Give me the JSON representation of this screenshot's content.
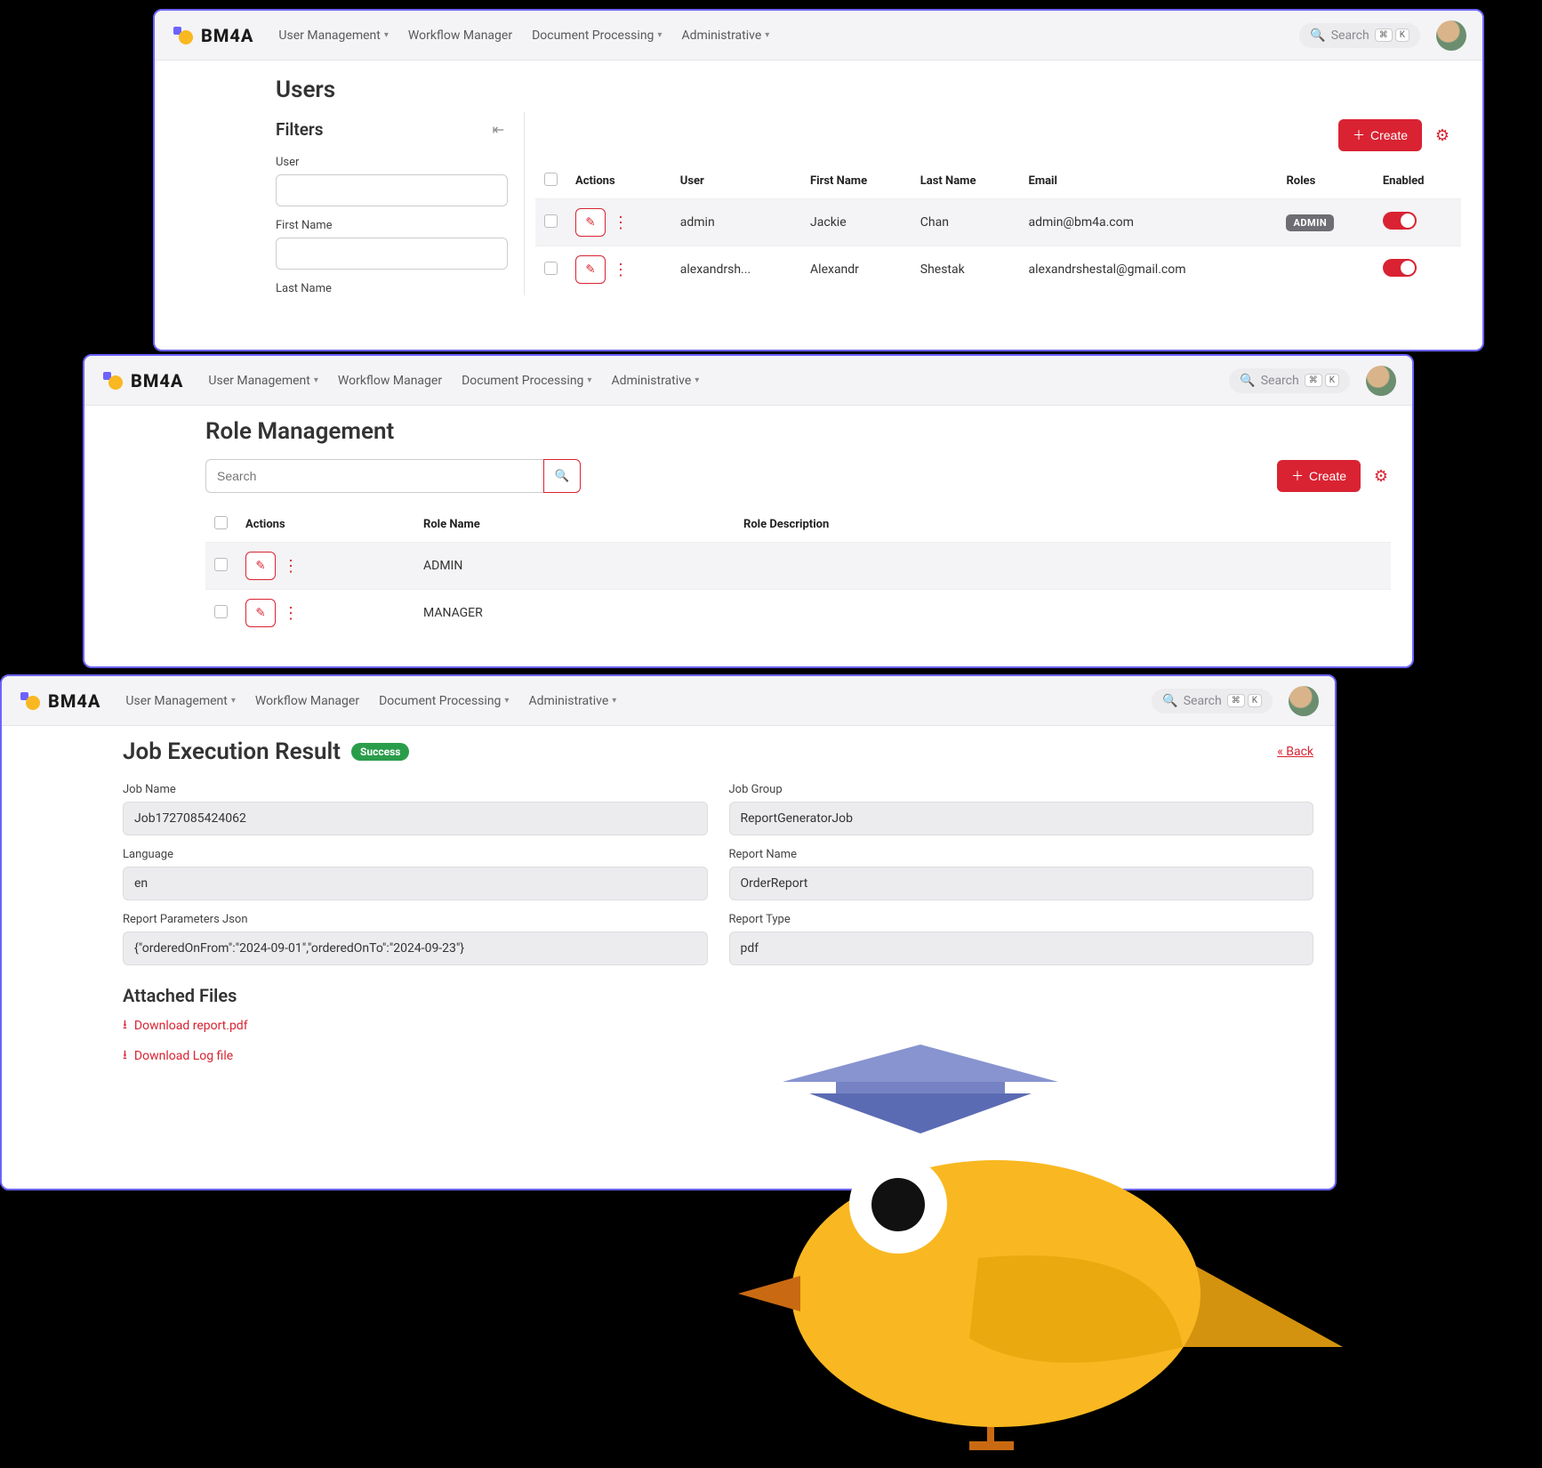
{
  "brand": "BM4A",
  "nav": {
    "items": [
      {
        "label": "User Management",
        "caret": true
      },
      {
        "label": "Workflow Manager",
        "caret": false
      },
      {
        "label": "Document Processing",
        "caret": true
      },
      {
        "label": "Administrative",
        "caret": true
      }
    ],
    "search_placeholder": "Search",
    "kbd1": "⌘",
    "kbd2": "K"
  },
  "win1": {
    "title": "Users",
    "filters_title": "Filters",
    "filter_user_label": "User",
    "filter_firstname_label": "First Name",
    "filter_lastname_label": "Last Name",
    "create_label": "Create",
    "cols": {
      "actions": "Actions",
      "user": "User",
      "firstname": "First Name",
      "lastname": "Last Name",
      "email": "Email",
      "roles": "Roles",
      "enabled": "Enabled"
    },
    "rows": [
      {
        "user": "admin",
        "first": "Jackie",
        "last": "Chan",
        "email": "admin@bm4a.com",
        "role": "ADMIN"
      },
      {
        "user": "alexandrsh...",
        "first": "Alexandr",
        "last": "Shestak",
        "email": "alexandrshestal@gmail.com",
        "role": ""
      }
    ]
  },
  "win2": {
    "title": "Role Management",
    "search_placeholder": "Search",
    "create_label": "Create",
    "cols": {
      "actions": "Actions",
      "name": "Role Name",
      "desc": "Role Description"
    },
    "rows": [
      {
        "name": "ADMIN",
        "desc": ""
      },
      {
        "name": "MANAGER",
        "desc": ""
      }
    ]
  },
  "win3": {
    "title": "Job Execution Result",
    "status": "Success",
    "back": "« Back",
    "labels": {
      "jobname": "Job Name",
      "jobgroup": "Job Group",
      "language": "Language",
      "reportname": "Report Name",
      "params": "Report Parameters Json",
      "reporttype": "Report Type"
    },
    "values": {
      "jobname": "Job1727085424062",
      "jobgroup": "ReportGeneratorJob",
      "language": "en",
      "reportname": "OrderReport",
      "params": "{\"orderedOnFrom\":\"2024-09-01\",\"orderedOnTo\":\"2024-09-23\"}",
      "reporttype": "pdf"
    },
    "attached_title": "Attached Files",
    "downloads": {
      "report": "Download report.pdf",
      "log": "Download Log file"
    }
  }
}
